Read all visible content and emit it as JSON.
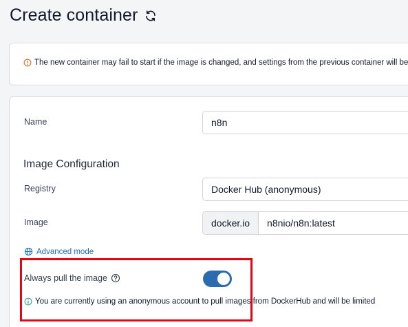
{
  "header": {
    "title": "Create container"
  },
  "warning": {
    "text": "The new container may fail to start if the image is changed, and settings from the previous container will be lost."
  },
  "form": {
    "name_label": "Name",
    "name_value": "n8n",
    "image_section_title": "Image Configuration",
    "registry_label": "Registry",
    "registry_value": "Docker Hub (anonymous)",
    "image_label": "Image",
    "image_prefix": "docker.io",
    "image_value": "n8nio/n8n:latest",
    "advanced_mode": "Advanced mode",
    "always_pull_label": "Always pull the image",
    "always_pull_enabled": true,
    "info_text": "You are currently using an anonymous account to pull images from DockerHub and will be limited"
  },
  "colors": {
    "accent": "#2b6cb0",
    "link": "#1f6fb5",
    "warning_icon": "#e8702a",
    "info_icon": "#2aa198",
    "highlight": "#e30613"
  }
}
